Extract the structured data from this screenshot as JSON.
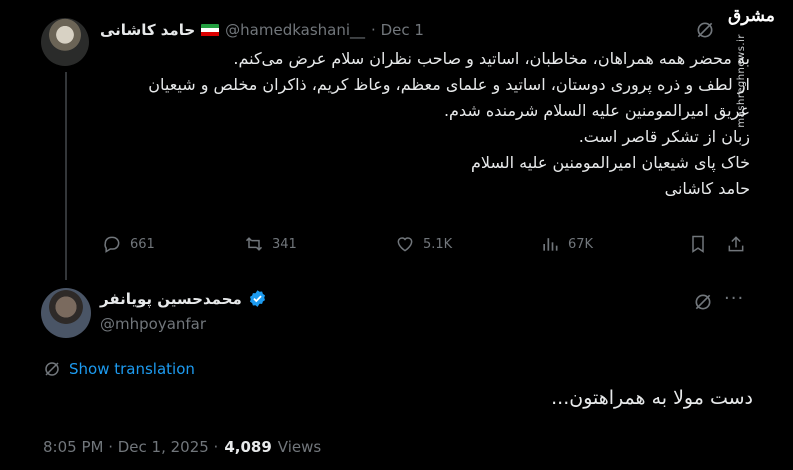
{
  "original_tweet": {
    "display_name": "حامد کاشانی",
    "flag_icon": "iran-flag-icon",
    "handle": "@hamedkashani__",
    "date": "· Dec 1",
    "lines": [
      "به محضر همه همراهان، مخاطبان، اساتید و صاحب نظران سلام عرض می‌کنم.",
      "از لطف و ذره پروری دوستان، اساتید و علمای معظم، وعاظ کریم، ذاکران مخلص و شیعیان",
      "عریق امیرالمومنین علیه السلام شرمنده شدم.",
      "زبان از تشکر قاصر است.",
      "خاک پای شیعیان امیرالمومنین علیه السلام",
      "حامد کاشانی"
    ],
    "stats": {
      "replies": "661",
      "retweets": "341",
      "likes": "5.1K",
      "views": "67K"
    }
  },
  "watermark": {
    "logo": "مشرق",
    "url": "mashreghnews.ir"
  },
  "reply_tweet": {
    "display_name": "محمدحسین پویانفر",
    "handle": "@mhpoyanfar",
    "more_label": "···",
    "translate_label": "Show translation",
    "text": "دست مولا به همراهتون...",
    "time": "8:05 PM · Dec 1, 2025 ·",
    "view_count": "4,089",
    "views_label": "Views"
  },
  "colors": {
    "background": "#000000",
    "text": "#e7e9ea",
    "muted": "#71767b",
    "accent": "#1d9bf0",
    "thread_line": "#333639"
  }
}
